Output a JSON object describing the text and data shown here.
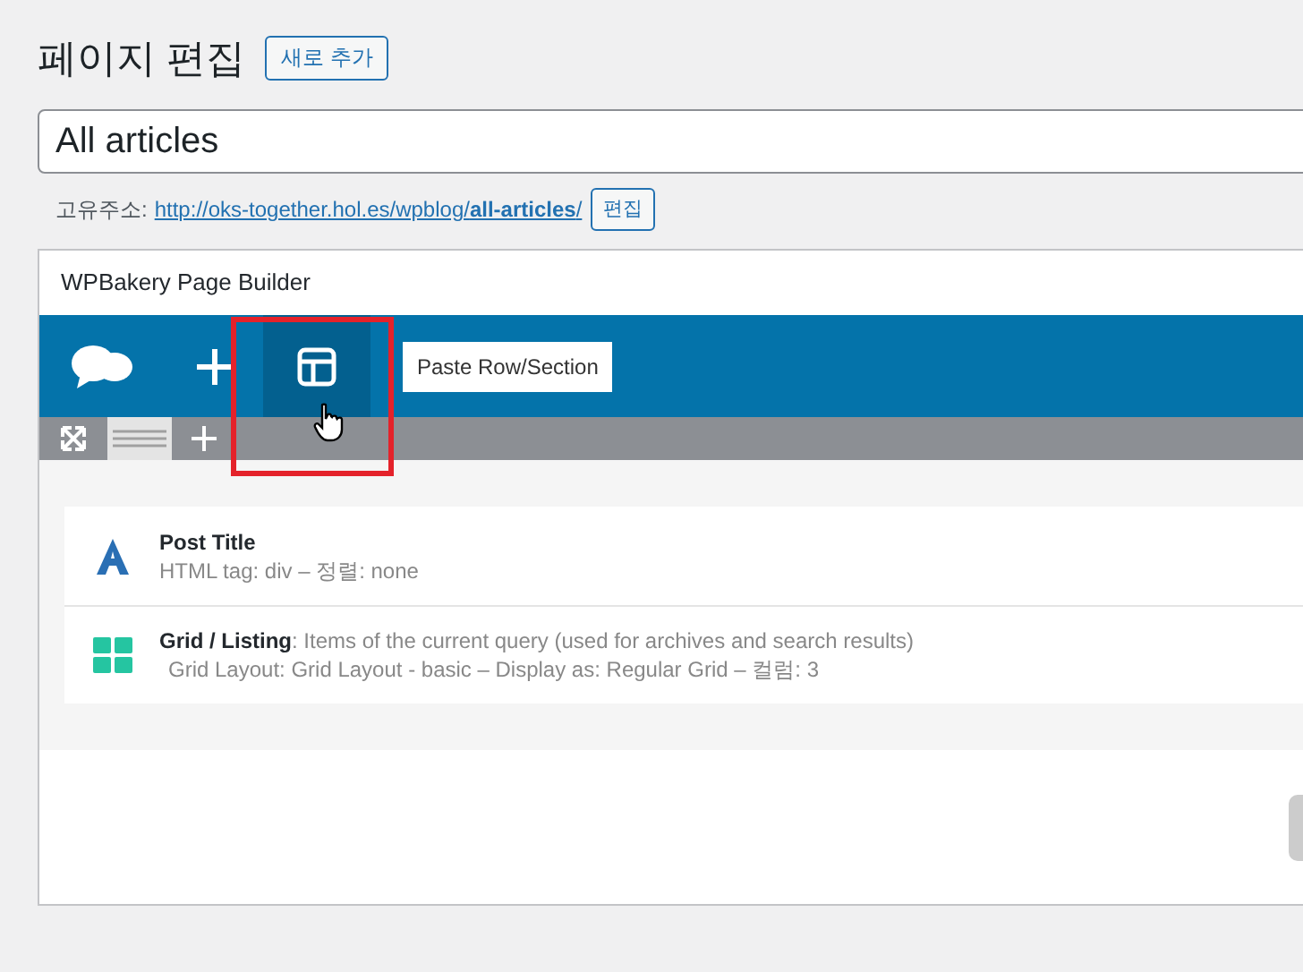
{
  "heading": "페이지 편집",
  "add_new_button": "새로 추가",
  "post_title": {
    "value": "All articles"
  },
  "permalink": {
    "label": "고유주소:",
    "url": "http://oks-together.hol.es/wpblog/**all-articles**/",
    "edit_button": "편집"
  },
  "builder": {
    "title": "WPBakery Page Builder",
    "tooltip": "Paste Row/Section",
    "elements": [
      {
        "kind": "title",
        "title": "Post Title",
        "detail": "HTML tag: div – 정렬: none"
      },
      {
        "kind": "grid",
        "title": "**Grid / Listing**: Items of the current query (used for archives and search results)",
        "detail": "Grid Layout: Grid Layout - basic – Display as: Regular Grid – 컬럼: 3"
      }
    ]
  }
}
